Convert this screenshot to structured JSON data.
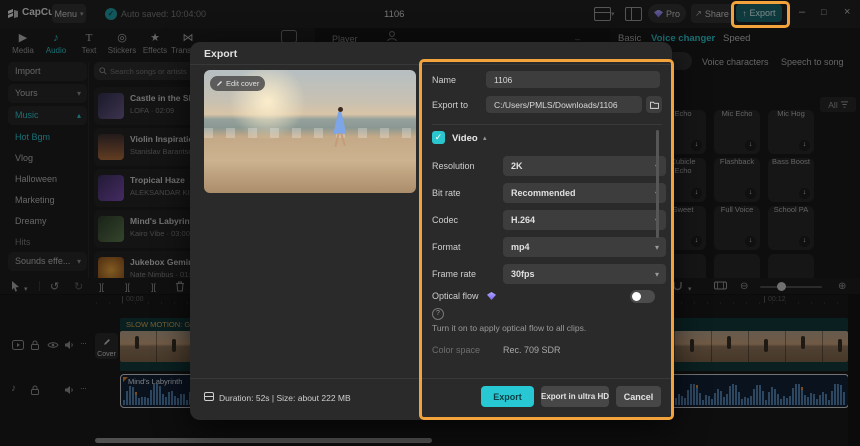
{
  "icons": {
    "check": "✓",
    "caret_down": "▾",
    "caret_up": "▴",
    "minimize": "–",
    "maximize": "□",
    "close": "×",
    "undo": "↺",
    "redo": "↻",
    "split": "][",
    "more": "···",
    "zoom_out": "⊖",
    "zoom_in": "⊕",
    "note": "♪",
    "play": "▶",
    "text_tool": "T",
    "sticker": "◎",
    "effects": "★",
    "transitions": "⋈",
    "share": "↗",
    "export_arrow": "↑",
    "help": "?",
    "download": "↓"
  },
  "topbar": {
    "app_name": "CapCut",
    "menu": "Menu",
    "autosave": "Auto saved: 10:04:00",
    "doc_title": "1106",
    "pro": "Pro",
    "share": "Share",
    "export": "Export"
  },
  "player": {
    "label": "Player"
  },
  "media_panel": {
    "tabs": [
      "Media",
      "Audio",
      "Text",
      "Stickers",
      "Effects",
      "Transitions"
    ],
    "sidebar": [
      "Import",
      "Yours",
      "Music",
      "Hot Bgm",
      "Vlog",
      "Halloween",
      "Marketing",
      "Dreamy",
      "Hits",
      "Sounds effe..."
    ],
    "search_placeholder": "Search songs or artists",
    "songs": [
      {
        "title": "Castle in the Sky",
        "meta": "LOFA · 02:09"
      },
      {
        "title": "Violin Inspiration",
        "meta": "Stanislav Barantsov"
      },
      {
        "title": "Tropical Haze",
        "meta": "ALEKSANDAR KIPRO"
      },
      {
        "title": "Mind's Labyrinth",
        "meta": "Kairo Vibe · 03:00"
      },
      {
        "title": "Jukebox Gemini",
        "meta": "Nate Nimbus · 01:00"
      }
    ]
  },
  "export_dialog": {
    "title": "Export",
    "edit_cover": "Edit cover",
    "name_label": "Name",
    "name_value": "1106",
    "export_to_label": "Export to",
    "export_to_value": "C:/Users/PMLS/Downloads/1106",
    "video_label": "Video",
    "fields": [
      {
        "label": "Resolution",
        "value": "2K"
      },
      {
        "label": "Bit rate",
        "value": "Recommended"
      },
      {
        "label": "Codec",
        "value": "H.264"
      },
      {
        "label": "Format",
        "value": "mp4"
      },
      {
        "label": "Frame rate",
        "value": "30fps"
      }
    ],
    "optical_flow_label": "Optical flow",
    "optical_hint": "Turn it on to apply optical flow to all clips.",
    "color_space_label": "Color space",
    "color_space_value": "Rec. 709 SDR",
    "summary": "Duration: 52s | Size: about 222 MB",
    "export_btn": "Export",
    "ultra_btn": "Export in ultra HD",
    "cancel_btn": "Cancel"
  },
  "voice_panel": {
    "tabs": [
      "Basic",
      "Voice changer",
      "Speed"
    ],
    "segments": [
      "Voice characters",
      "Speech to song"
    ],
    "filter": "All",
    "tiles": [
      "Echo",
      "Mic Echo",
      "Mic Hog",
      "Cubicle Echo",
      "Flashback",
      "Bass Boost",
      "Sweet",
      "Full Voice",
      "School PA"
    ]
  },
  "timeline": {
    "ruler_start": "00:00",
    "ruler_mark": "00:12",
    "cover": "Cover",
    "text_clip": "SLOW MOTION: Girl",
    "audio_clip": "Mind's Labyrinth"
  },
  "colors": {
    "accent": "#2ac7cf",
    "orange": "#f2a33c",
    "gem": "#8b7bf7",
    "export_button": "#27c7d3"
  }
}
